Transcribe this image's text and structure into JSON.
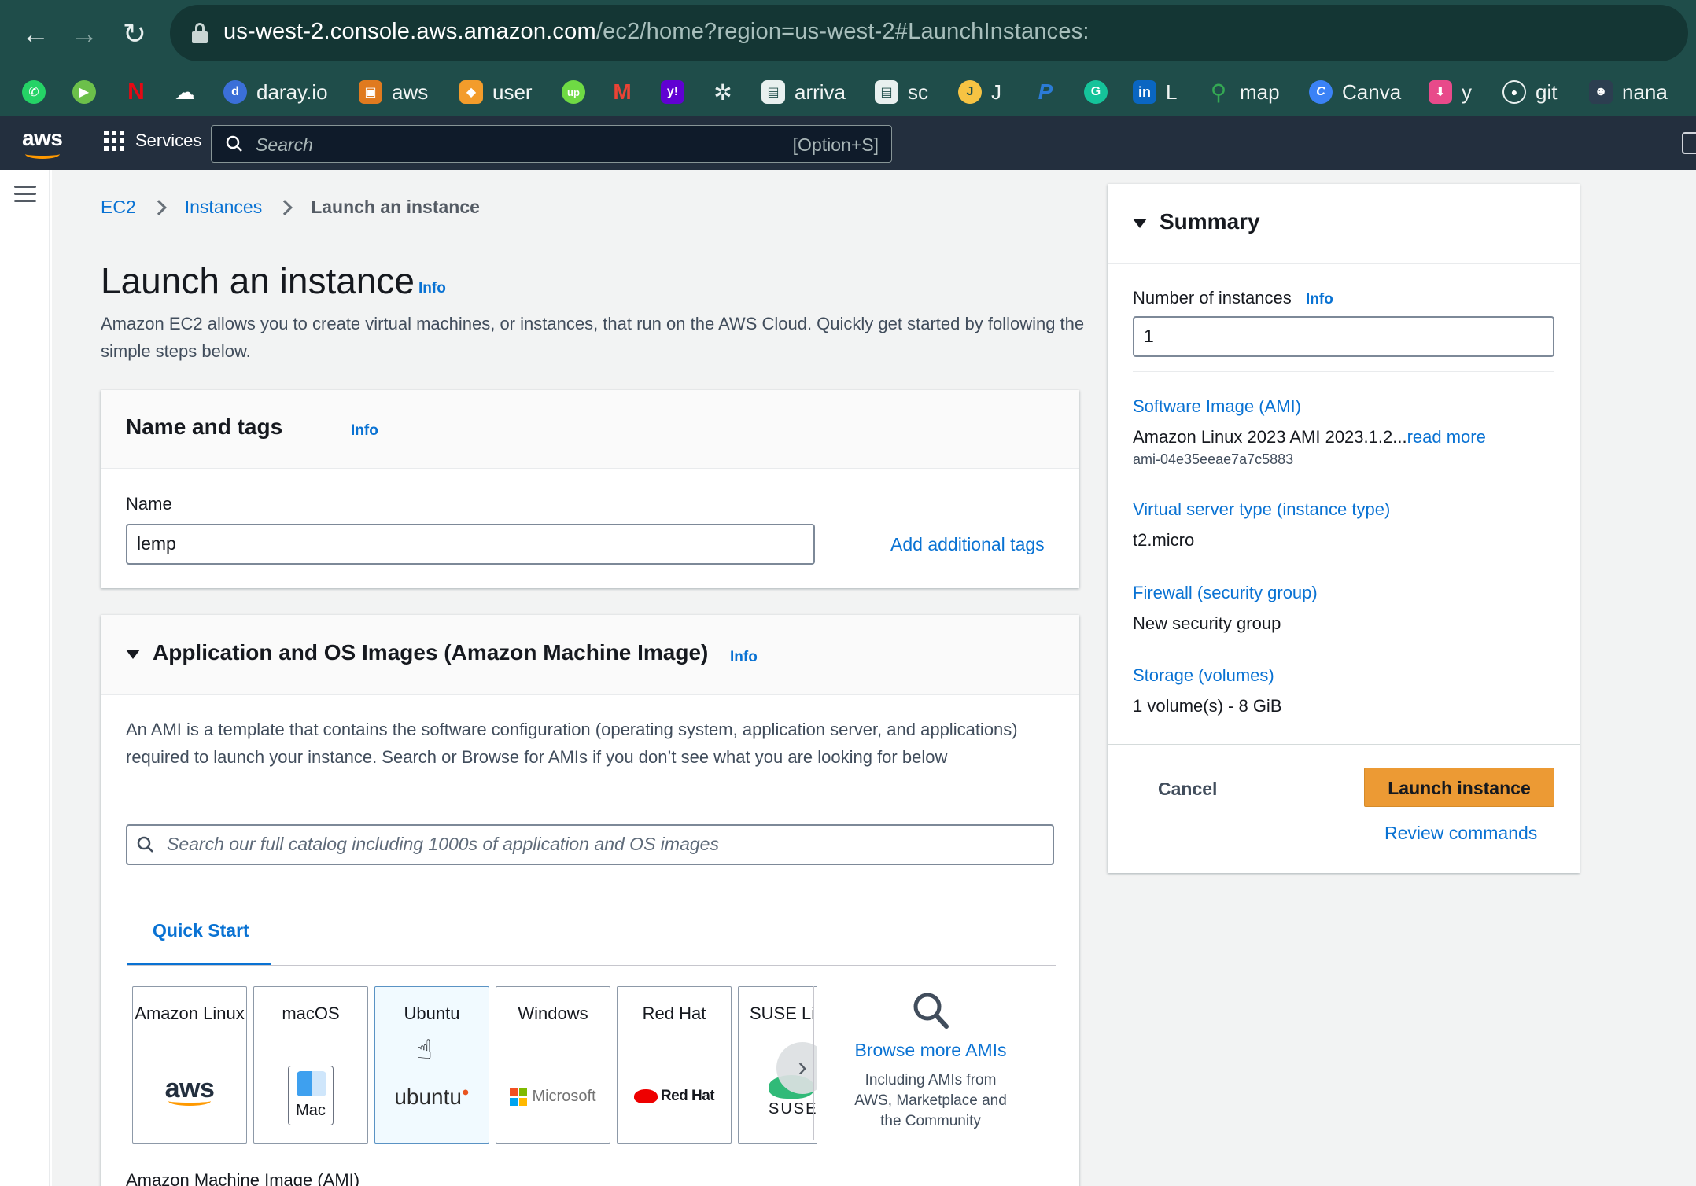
{
  "browser": {
    "url_host": "us-west-2.console.aws.amazon.com",
    "url_path": "/ec2/home?region=us-west-2#LaunchInstances:",
    "bookmarks": [
      {
        "label": "",
        "icon": "whatsapp-icon"
      },
      {
        "label": "",
        "icon": "play-icon"
      },
      {
        "label": "",
        "icon": "netflix-icon"
      },
      {
        "label": "",
        "icon": "cloud-icon"
      },
      {
        "label": "daray.io",
        "icon": "daray-icon"
      },
      {
        "label": "aws",
        "icon": "aws-bookmark-icon"
      },
      {
        "label": "user",
        "icon": "box-icon"
      },
      {
        "label": "",
        "icon": "upwork-icon"
      },
      {
        "label": "",
        "icon": "gmail-icon"
      },
      {
        "label": "",
        "icon": "yahoo-icon"
      },
      {
        "label": "",
        "icon": "chatgpt-icon"
      },
      {
        "label": "arriva",
        "icon": "document-icon"
      },
      {
        "label": "sc",
        "icon": "document-icon"
      },
      {
        "label": "J",
        "icon": "j-icon"
      },
      {
        "label": "",
        "icon": "paypal-icon"
      },
      {
        "label": "",
        "icon": "grammarly-icon"
      },
      {
        "label": "L",
        "icon": "linkedin-icon"
      },
      {
        "label": "map",
        "icon": "maps-icon"
      },
      {
        "label": "Canva",
        "icon": "canva-icon"
      },
      {
        "label": "y",
        "icon": "download-icon"
      },
      {
        "label": "git",
        "icon": "github-icon"
      },
      {
        "label": "nana",
        "icon": "nana-icon"
      }
    ]
  },
  "aws_nav": {
    "logo": "aws",
    "services_label": "Services",
    "search_placeholder": "Search",
    "search_shortcut": "[Option+S]"
  },
  "breadcrumb": {
    "ec2": "EC2",
    "instances": "Instances",
    "current": "Launch an instance"
  },
  "page": {
    "title": "Launch an instance",
    "info": "Info",
    "description": "Amazon EC2 allows you to create virtual machines, or instances, that run on the AWS Cloud. Quickly get started by following the simple steps below."
  },
  "name_tags": {
    "title": "Name and tags",
    "info": "Info",
    "name_label": "Name",
    "name_value": "lemp",
    "add_tags": "Add additional tags"
  },
  "ami": {
    "title": "Application and OS Images (Amazon Machine Image)",
    "info": "Info",
    "description": "An AMI is a template that contains the software configuration (operating system, application server, and applications) required to launch your instance. Search or Browse for AMIs if you don’t see what you are looking for below",
    "search_placeholder": "Search our full catalog including 1000s of application and OS images",
    "tab": "Quick Start",
    "cards": [
      {
        "name": "Amazon Linux",
        "logo": "aws"
      },
      {
        "name": "macOS",
        "logo": "Mac"
      },
      {
        "name": "Ubuntu",
        "logo": "ubuntu"
      },
      {
        "name": "Windows",
        "logo": "Microsoft"
      },
      {
        "name": "Red Hat",
        "logo": "Red Hat"
      },
      {
        "name": "SUSE Li",
        "logo": "SUSE"
      }
    ],
    "browse_title": "Browse more AMIs",
    "browse_desc": "Including AMIs from AWS, Marketplace and the Community",
    "section_label": "Amazon Machine Image (AMI)"
  },
  "summary": {
    "title": "Summary",
    "instances_label": "Number of instances",
    "info": "Info",
    "instances_value": "1",
    "software_image_label": "Software Image (AMI)",
    "software_image_value": "Amazon Linux 2023 AMI 2023.1.2...",
    "read_more": "read more",
    "ami_id": "ami-04e35eeae7a7c5883",
    "instance_type_label": "Virtual server type (instance type)",
    "instance_type_value": "t2.micro",
    "firewall_label": "Firewall (security group)",
    "firewall_value": "New security group",
    "storage_label": "Storage (volumes)",
    "storage_value": "1 volume(s) - 8 GiB",
    "cancel": "Cancel",
    "launch": "Launch instance",
    "review": "Review commands"
  },
  "colors": {
    "browser_chrome": "#1f4d4a",
    "aws_nav": "#232f3e",
    "link": "#0972d3",
    "primary_button": "#ec9a34"
  }
}
